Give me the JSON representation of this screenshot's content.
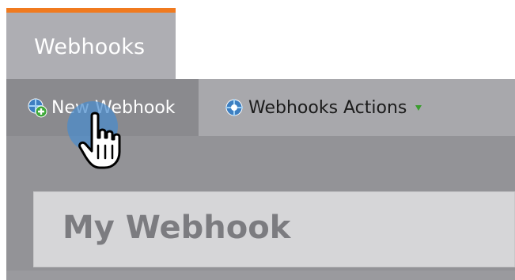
{
  "tab": {
    "label": "Webhooks",
    "accent_color": "#f07a1f"
  },
  "toolbar": {
    "new_label": "New Webhook",
    "new_icon": "add-webhook-icon",
    "actions_label": "Webhooks Actions",
    "actions_icon": "webhook-actions-icon",
    "actions_caret": "dropdown-caret-icon"
  },
  "content": {
    "name_value": "My Webhook"
  },
  "cursor": {
    "icon": "hand-pointer-icon",
    "highlight_color": "#4a8ccd"
  }
}
